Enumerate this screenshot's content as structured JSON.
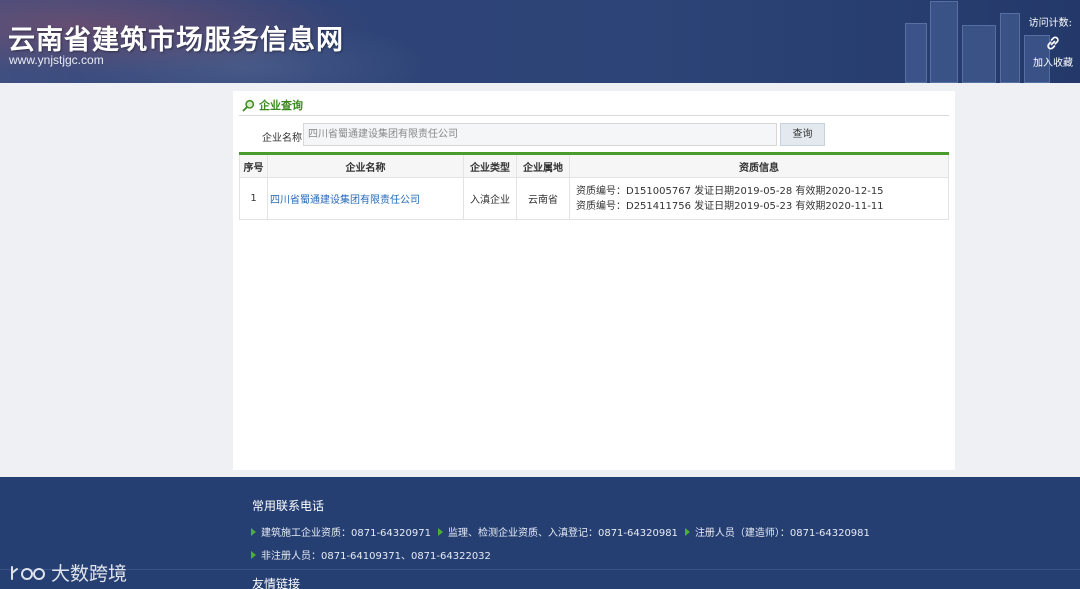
{
  "header": {
    "title": "云南省建筑市场服务信息网",
    "url": "www.ynjstjgc.com",
    "visit_label": "访问计数:",
    "favorite_label": "加入收藏",
    "favorite_icon": "link-icon"
  },
  "panel": {
    "title": "企业查询",
    "title_icon": "search-icon",
    "search": {
      "label": "企业名称",
      "value": "四川省蜀通建设集团有限责任公司",
      "button": "查询"
    },
    "table": {
      "headers": [
        "序号",
        "企业名称",
        "企业类型",
        "企业属地",
        "资质信息"
      ],
      "rows": [
        {
          "index": "1",
          "name": "四川省蜀通建设集团有限责任公司",
          "type": "入滇企业",
          "location": "云南省",
          "qualifications": [
            "资质编号：D151005767 发证日期2019-05-28 有效期2020-12-15",
            "资质编号：D251411756 发证日期2019-05-23 有效期2020-11-11"
          ]
        }
      ]
    }
  },
  "footer": {
    "contacts_title": "常用联系电话",
    "contacts_line1": [
      "建筑施工企业资质：0871-64320971",
      "监理、检测企业资质、入滇登记：0871-64320981",
      "注册人员（建造师）：0871-64320981"
    ],
    "contacts_line2": [
      "非注册人员：0871-64109371、0871-64322032"
    ],
    "links_title": "友情链接"
  },
  "watermark": {
    "text": "大数跨境"
  },
  "colors": {
    "header_bg": "#2c4477",
    "footer_bg": "#263f72",
    "accent_green": "#4a9b2d",
    "link_blue": "#2769b5"
  }
}
